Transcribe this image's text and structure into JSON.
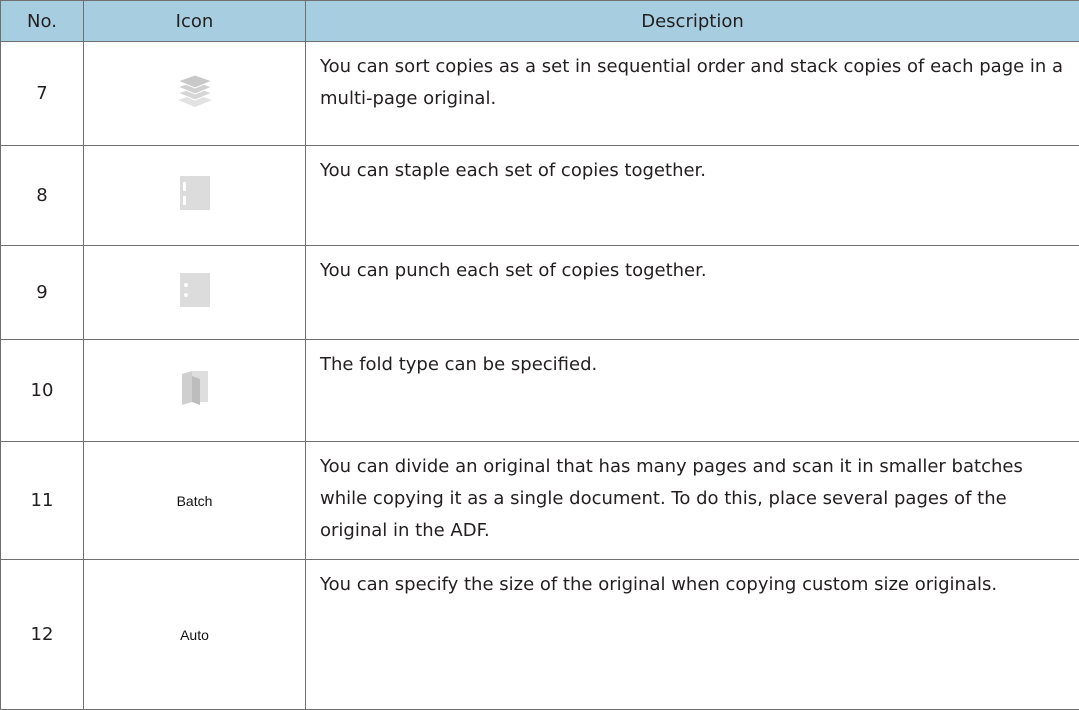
{
  "header": {
    "no": "No.",
    "icon": "Icon",
    "description": "Description"
  },
  "rows": [
    {
      "no": "7",
      "icon": "stack-copies-icon",
      "description": "You can sort copies as a set in sequential order and stack copies of each page in a multi-page original."
    },
    {
      "no": "8",
      "icon": "staple-icon",
      "description": "You can staple each set of copies together."
    },
    {
      "no": "9",
      "icon": "punch-icon",
      "description": "You can punch each set of copies together."
    },
    {
      "no": "10",
      "icon": "fold-icon",
      "description": "The fold type can be specified."
    },
    {
      "no": "11",
      "icon_text": "Batch",
      "description": "You can divide an original that has many pages and scan it in smaller batches while copying it as a single document. To do this, place several pages of the original in the ADF."
    },
    {
      "no": "12",
      "icon_text": "Auto",
      "description": "You can specify the size of the original when copying custom size originals."
    }
  ],
  "colors": {
    "header_bg": "#a6cde0",
    "icon_gray": "#dcdcdc",
    "border": "#6f6f6f"
  }
}
